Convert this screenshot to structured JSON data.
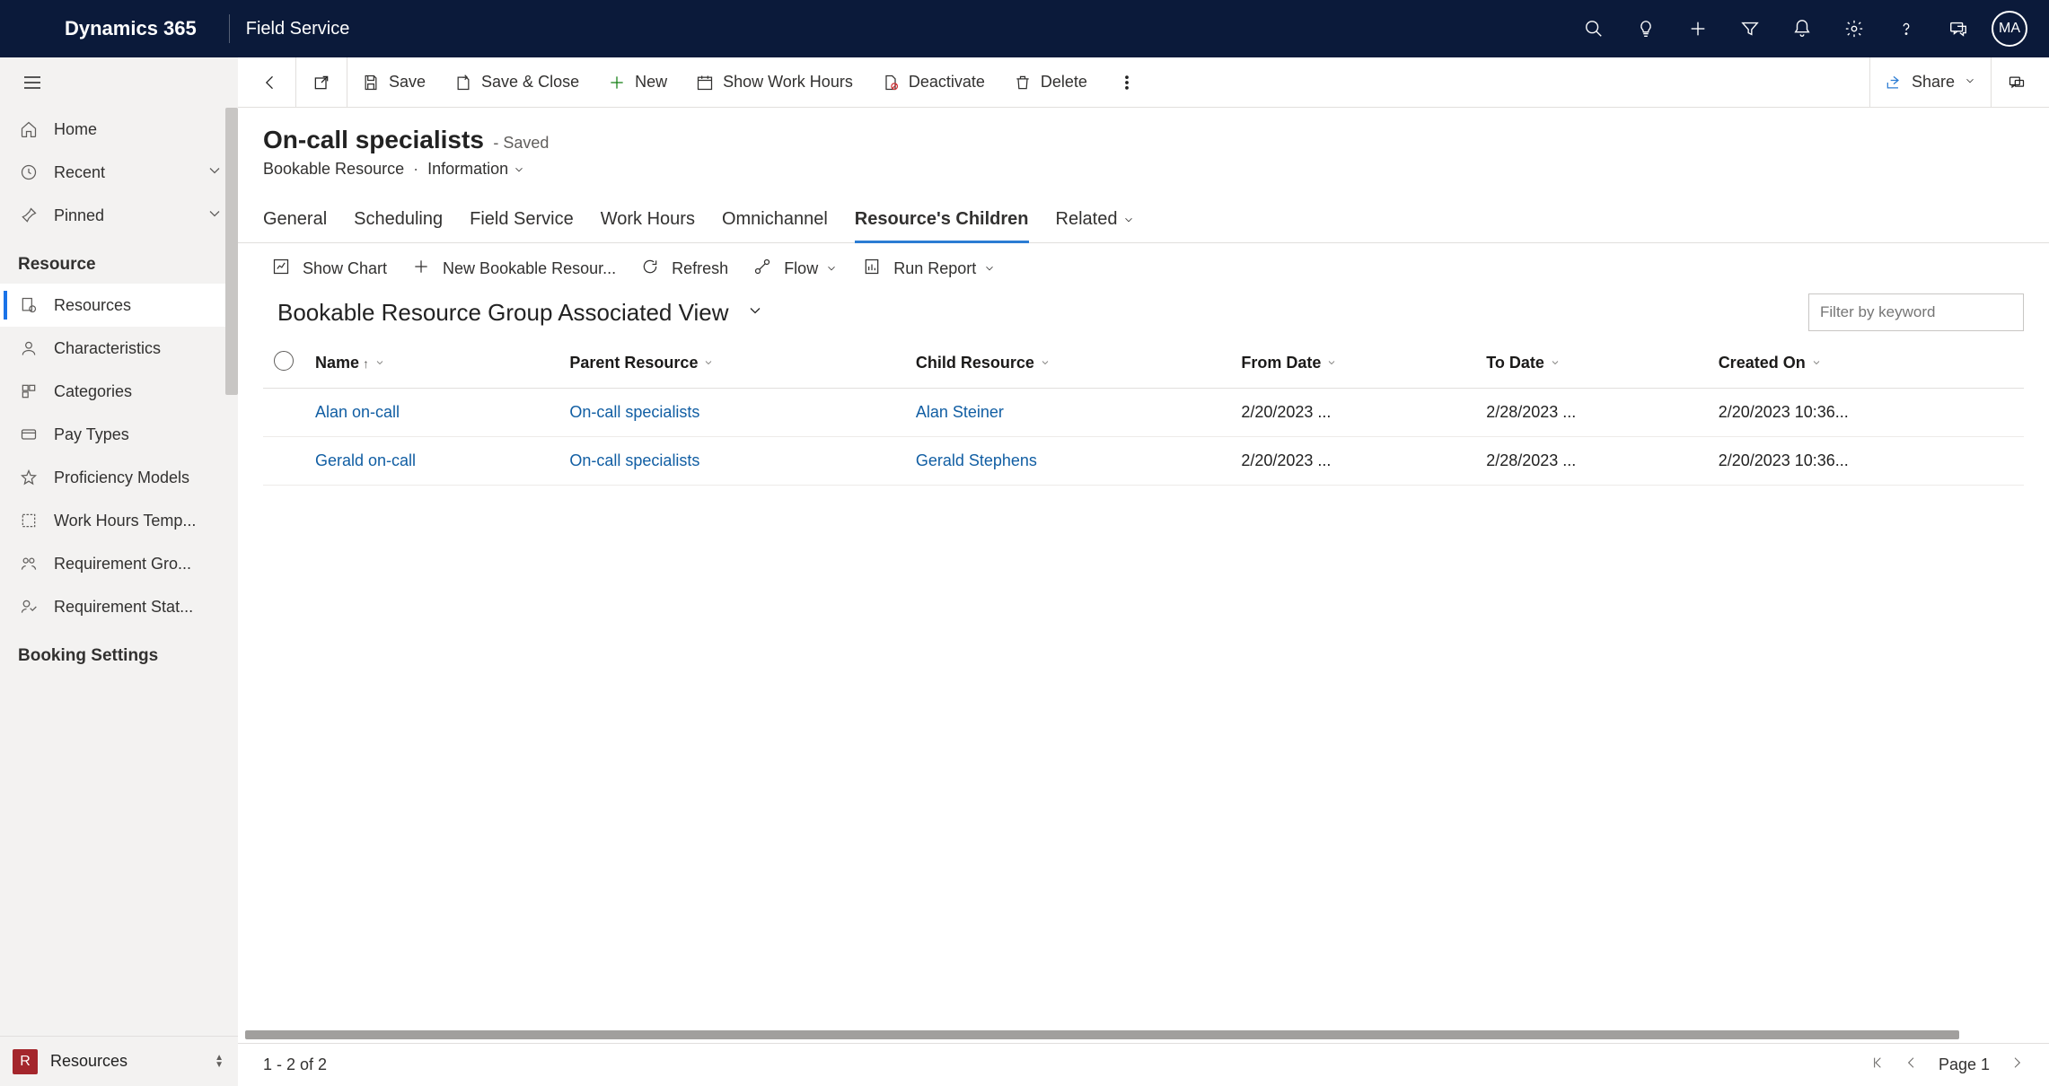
{
  "topbar": {
    "brand": "Dynamics 365",
    "app": "Field Service",
    "avatar": "MA"
  },
  "nav": {
    "home": "Home",
    "recent": "Recent",
    "pinned": "Pinned",
    "group1": "Resource",
    "items": [
      "Resources",
      "Characteristics",
      "Categories",
      "Pay Types",
      "Proficiency Models",
      "Work Hours Temp...",
      "Requirement Gro...",
      "Requirement Stat..."
    ],
    "group2": "Booking Settings",
    "area": "Resources",
    "areaBadge": "R"
  },
  "cmd": {
    "save": "Save",
    "saveclose": "Save & Close",
    "new": "New",
    "showhours": "Show Work Hours",
    "deactivate": "Deactivate",
    "delete": "Delete",
    "share": "Share"
  },
  "record": {
    "title": "On-call specialists",
    "status": "- Saved",
    "entity": "Bookable Resource",
    "form": "Information"
  },
  "tabs": [
    "General",
    "Scheduling",
    "Field Service",
    "Work Hours",
    "Omnichannel",
    "Resource's Children",
    "Related"
  ],
  "activeTab": 5,
  "subcmd": {
    "showchart": "Show Chart",
    "newchild": "New Bookable Resour...",
    "refresh": "Refresh",
    "flow": "Flow",
    "runreport": "Run Report"
  },
  "view": {
    "name": "Bookable Resource Group Associated View",
    "filterPlaceholder": "Filter by keyword"
  },
  "grid": {
    "cols": [
      "Name",
      "Parent Resource",
      "Child Resource",
      "From Date",
      "To Date",
      "Created On"
    ],
    "rows": [
      {
        "name": "Alan on-call",
        "parent": "On-call specialists",
        "child": "Alan Steiner",
        "from": "2/20/2023 ...",
        "to": "2/28/2023 ...",
        "created": "2/20/2023 10:36..."
      },
      {
        "name": "Gerald on-call",
        "parent": "On-call specialists",
        "child": "Gerald Stephens",
        "from": "2/20/2023 ...",
        "to": "2/28/2023 ...",
        "created": "2/20/2023 10:36..."
      }
    ]
  },
  "footer": {
    "count": "1 - 2 of 2",
    "page": "Page 1"
  }
}
